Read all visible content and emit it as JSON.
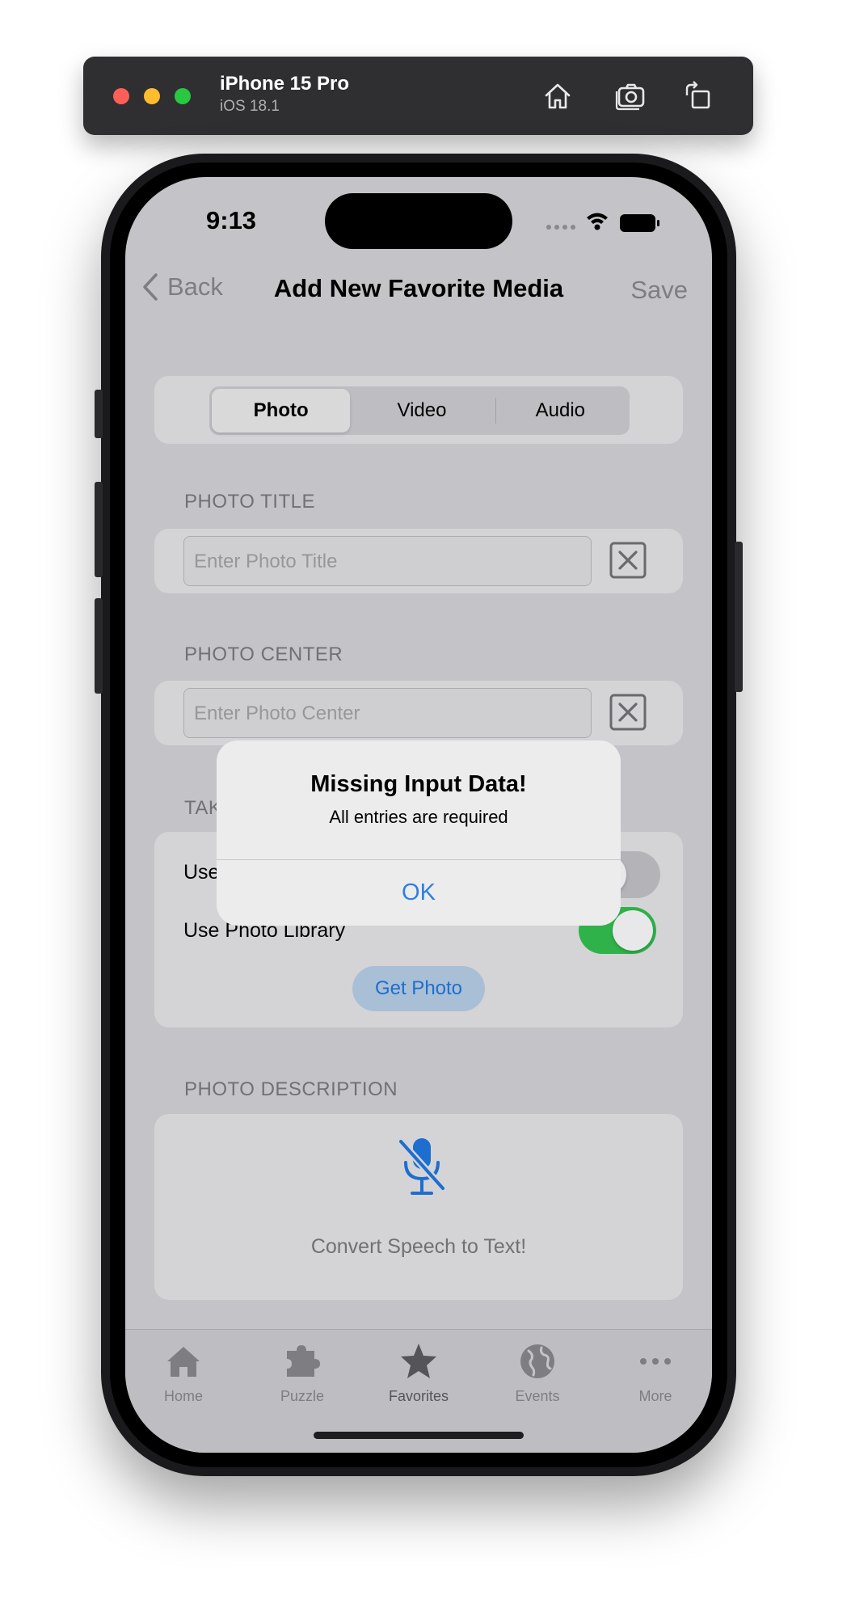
{
  "simulator": {
    "device_name": "iPhone 15 Pro",
    "os_version": "iOS 18.1",
    "buttons": [
      "home-icon",
      "screenshot-icon",
      "rotate-icon"
    ]
  },
  "status_bar": {
    "time": "9:13"
  },
  "nav": {
    "back_label": "Back",
    "title": "Add New Favorite Media",
    "save_label": "Save"
  },
  "media_type": {
    "options": [
      "Photo",
      "Video",
      "Audio"
    ],
    "selected": "Photo"
  },
  "title_section": {
    "label": "PHOTO TITLE",
    "placeholder": "Enter Photo Title"
  },
  "center_section": {
    "label": "PHOTO CENTER",
    "placeholder": "Enter Photo Center"
  },
  "take_section": {
    "label_visible": "TAK",
    "camera_label_visible": "Use",
    "camera_on": false,
    "library_label": "Use Photo Library",
    "library_on": true,
    "get_photo_label": "Get Photo"
  },
  "description_section": {
    "label": "PHOTO DESCRIPTION",
    "speech_label": "Convert Speech to Text!",
    "icon": "mic-slash-icon"
  },
  "tabs": [
    {
      "label": "Home",
      "icon": "house-icon"
    },
    {
      "label": "Puzzle",
      "icon": "puzzle-icon"
    },
    {
      "label": "Favorites",
      "icon": "star-icon"
    },
    {
      "label": "Events",
      "icon": "globe-icon"
    },
    {
      "label": "More",
      "icon": "ellipsis-icon"
    }
  ],
  "alert": {
    "title": "Missing Input Data!",
    "message": "All entries are required",
    "ok_label": "OK"
  },
  "colors": {
    "accent": "#2f7fe0",
    "toggle_on": "#2fb24a",
    "dim_background": "#c4c4c8"
  }
}
